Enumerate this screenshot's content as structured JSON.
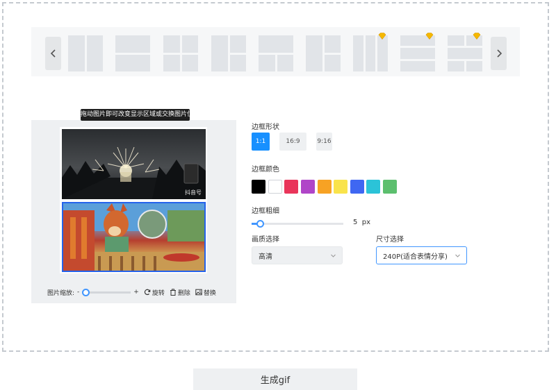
{
  "tooltip": "拖动图片即可改变显示区域或交换图片位置",
  "zoom": {
    "label": "图片缩放:",
    "minus": "-",
    "plus": "+",
    "level": 0
  },
  "tools": {
    "rotate": "旋转",
    "delete": "删除",
    "replace": "替换"
  },
  "photos": {
    "top_watermark": "抖音号"
  },
  "border_shape": {
    "label": "边框形状",
    "options": [
      "1:1",
      "16:9",
      "9:16"
    ],
    "selected": "1:1"
  },
  "border_color": {
    "label": "边框颜色",
    "colors": [
      "#000000",
      "#ffffff",
      "#e9355a",
      "#b045c8",
      "#f7a224",
      "#f9e34b",
      "#3f67f2",
      "#2bc3d8",
      "#5cbf6e"
    ]
  },
  "border_width": {
    "label": "边框粗细",
    "value": "5",
    "unit": "px"
  },
  "quality": {
    "label": "画质选择",
    "value": "高清"
  },
  "size": {
    "label": "尺寸选择",
    "value": "240P(适合表情分享)"
  },
  "generate_label": "生成gif",
  "colors": {
    "accent": "#1890ff",
    "selected_border": "#2563eb",
    "vip_badge": "#f5b800"
  }
}
